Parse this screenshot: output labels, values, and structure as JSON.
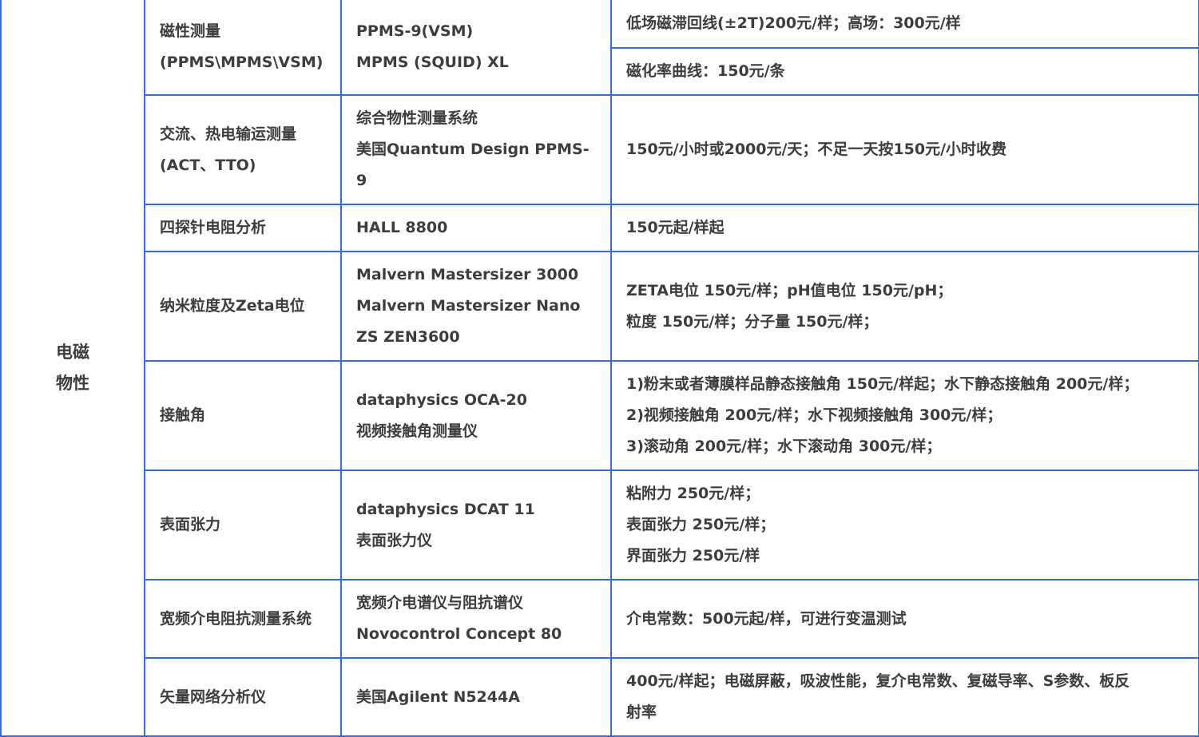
{
  "category": {
    "line1": "电磁",
    "line2": "物性"
  },
  "rows": [
    {
      "item": [
        "磁性测量",
        "(PPMS\\MPMS\\VSM)"
      ],
      "instrument": [
        "PPMS-9(VSM)",
        "MPMS (SQUID) XL"
      ],
      "price_split": [
        "低场磁滞回线(±2T)200元/样；高场：300元/样",
        "磁化率曲线：150元/条"
      ]
    },
    {
      "item": [
        "交流、热电输运测量",
        "(ACT、TTO)"
      ],
      "instrument": [
        "综合物性测量系统",
        "美国Quantum Design PPMS-",
        "9"
      ],
      "price": [
        "150元/小时或2000元/天；不足一天按150元/小时收费"
      ]
    },
    {
      "item": [
        "四探针电阻分析"
      ],
      "instrument": [
        "HALL 8800"
      ],
      "price": [
        "150元起/样起"
      ]
    },
    {
      "item": [
        "纳米粒度及Zeta电位"
      ],
      "instrument": [
        "Malvern Mastersizer 3000",
        "Malvern Mastersizer Nano",
        "ZS ZEN3600"
      ],
      "price": [
        "ZETA电位 150元/样；pH值电位 150元/pH；",
        "粒度 150元/样；分子量 150元/样；"
      ]
    },
    {
      "item": [
        "接触角"
      ],
      "instrument": [
        "dataphysics OCA-20",
        "视频接触角测量仪"
      ],
      "price": [
        "1)粉末或者薄膜样品静态接触角 150元/样起；水下静态接触角 200元/样；",
        "2)视频接触角 200元/样；水下视频接触角 300元/样；",
        "3)滚动角 200元/样；水下滚动角 300元/样；"
      ]
    },
    {
      "item": [
        "表面张力"
      ],
      "instrument": [
        "dataphysics DCAT 11",
        "表面张力仪"
      ],
      "price": [
        "粘附力 250元/样；",
        "表面张力 250元/样；",
        "界面张力 250元/样"
      ]
    },
    {
      "item": [
        "宽频介电阻抗测量系统"
      ],
      "instrument": [
        "宽频介电谱仪与阻抗谱仪",
        "Novocontrol Concept 80"
      ],
      "price": [
        "介电常数：500元起/样，可进行变温测试"
      ]
    },
    {
      "item": [
        "矢量网络分析仪"
      ],
      "instrument": [
        "美国Agilent N5244A"
      ],
      "price": [
        "400元/样起；电磁屏蔽，吸波性能，复介电常数、复磁导率、S参数、板反",
        "射率"
      ]
    }
  ]
}
